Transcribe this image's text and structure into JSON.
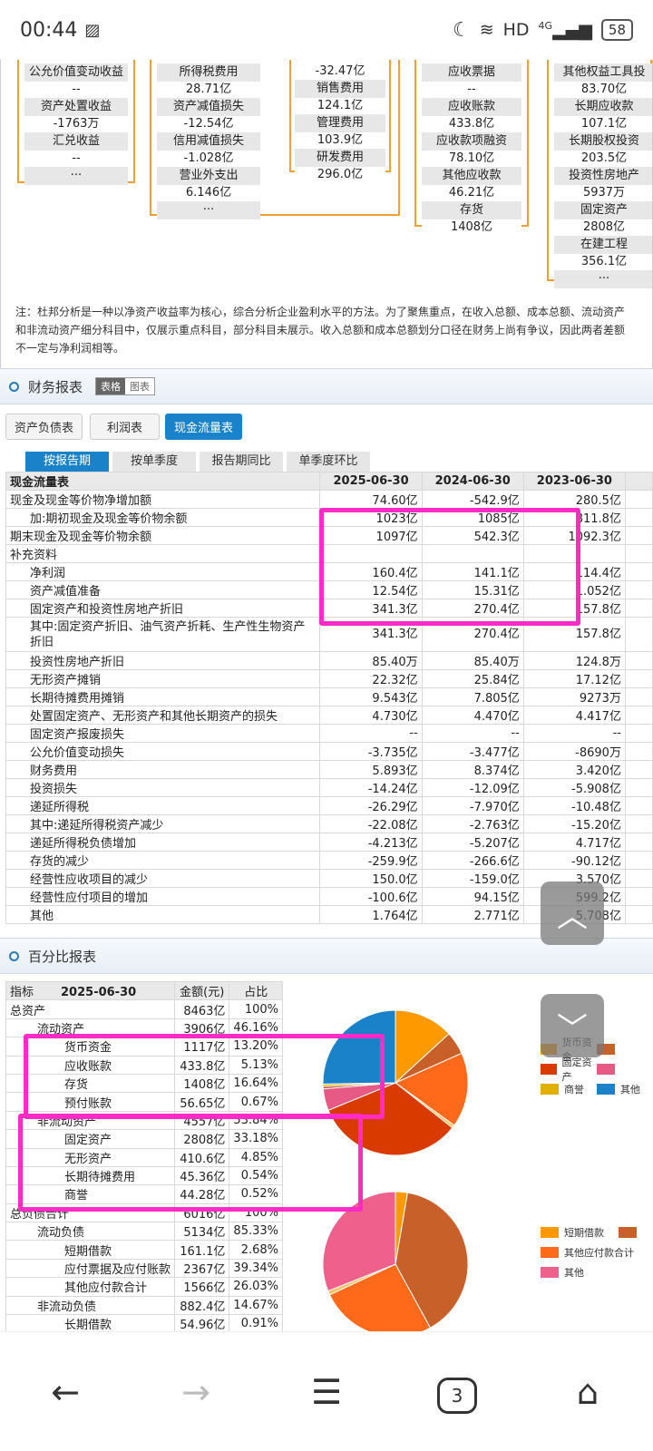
{
  "status": {
    "time": "00:44",
    "network": "HD",
    "signal": "4G",
    "battery": "58"
  },
  "dupont": {
    "col1": [
      {
        "label": "公允价值变动收益",
        "value": "--"
      },
      {
        "label": "资产处置收益",
        "value": "-1763万"
      },
      {
        "label": "汇兑收益",
        "value": "--"
      },
      {
        "label": "···",
        "value": ""
      }
    ],
    "col2": [
      {
        "label": "所得税费用",
        "value": "28.71亿"
      },
      {
        "label": "资产减值损失",
        "value": "-12.54亿"
      },
      {
        "label": "信用减值损失",
        "value": "-1.028亿"
      },
      {
        "label": "营业外支出",
        "value": "6.146亿"
      },
      {
        "label": "···",
        "value": ""
      }
    ],
    "col3_top_value": "-32.47亿",
    "col3": [
      {
        "label": "销售费用",
        "value": "124.1亿"
      },
      {
        "label": "管理费用",
        "value": "103.9亿"
      },
      {
        "label": "研发费用",
        "value": "296.0亿"
      }
    ],
    "col4": [
      {
        "label": "应收票据",
        "value": "--"
      },
      {
        "label": "应收账款",
        "value": "433.8亿"
      },
      {
        "label": "应收款项融资",
        "value": "78.10亿"
      },
      {
        "label": "其他应收款",
        "value": "46.21亿"
      },
      {
        "label": "存货",
        "value": "1408亿"
      }
    ],
    "col5": [
      {
        "label": "其他权益工具投",
        "value": "83.70亿"
      },
      {
        "label": "长期应收款",
        "value": "107.1亿"
      },
      {
        "label": "长期股权投资",
        "value": "203.5亿"
      },
      {
        "label": "投资性房地产",
        "value": "5937万"
      },
      {
        "label": "固定资产",
        "value": "2808亿"
      },
      {
        "label": "在建工程",
        "value": "356.1亿"
      },
      {
        "label": "···",
        "value": ""
      }
    ],
    "note": "注：杜邦分析是一种以净资产收益率为核心，综合分析企业盈利水平的方法。为了聚焦重点，在收入总额、成本总额、流动资产和非流动资产细分科目中，仅展示重点科目，部分科目未展示。收入总额和成本总额划分口径在财务上尚有争议，因此两者差额不一定与净利润相等。"
  },
  "finance": {
    "title": "财务报表",
    "view_table": "表格",
    "view_chart": "图表",
    "subtabs": [
      "资产负债表",
      "利润表",
      "现金流量表"
    ],
    "periods": [
      "按报告期",
      "按单季度",
      "报告期同比",
      "单季度环比"
    ],
    "header": [
      "现金流量表",
      "2025-06-30",
      "2024-06-30",
      "2023-06-30"
    ],
    "rows": [
      {
        "name": "现金及现金等价物净增加额",
        "v": [
          "74.60亿",
          "-542.9亿",
          "280.5亿"
        ],
        "ind": false
      },
      {
        "name": "加:期初现金及现金等价物余额",
        "v": [
          "1023亿",
          "1085亿",
          "811.8亿"
        ],
        "ind": true
      },
      {
        "name": "期末现金及现金等价物余额",
        "v": [
          "1097亿",
          "542.3亿",
          "1092.3亿"
        ],
        "ind": false
      },
      {
        "name": "补充资料",
        "v": [
          "",
          "",
          ""
        ],
        "ind": false
      },
      {
        "name": "净利润",
        "v": [
          "160.4亿",
          "141.1亿",
          "114.4亿"
        ],
        "ind": true
      },
      {
        "name": "资产减值准备",
        "v": [
          "12.54亿",
          "15.31亿",
          "1.052亿"
        ],
        "ind": true
      },
      {
        "name": "固定资产和投资性房地产折旧",
        "v": [
          "341.3亿",
          "270.4亿",
          "157.8亿"
        ],
        "ind": true
      },
      {
        "name": "其中:固定资产折旧、油气资产折耗、生产性生物资产折旧",
        "v": [
          "341.3亿",
          "270.4亿",
          "157.8亿"
        ],
        "ind": true,
        "tall": true
      },
      {
        "name": "投资性房地产折旧",
        "v": [
          "85.40万",
          "85.40万",
          "124.8万"
        ],
        "ind": true
      },
      {
        "name": "无形资产摊销",
        "v": [
          "22.32亿",
          "25.84亿",
          "17.12亿"
        ],
        "ind": true
      },
      {
        "name": "长期待摊费用摊销",
        "v": [
          "9.543亿",
          "7.805亿",
          "9273万"
        ],
        "ind": true
      },
      {
        "name": "处置固定资产、无形资产和其他长期资产的损失",
        "v": [
          "4.730亿",
          "4.470亿",
          "4.417亿"
        ],
        "ind": true
      },
      {
        "name": "固定资产报废损失",
        "v": [
          "--",
          "--",
          "--"
        ],
        "ind": true
      },
      {
        "name": "公允价值变动损失",
        "v": [
          "-3.735亿",
          "-3.477亿",
          "-8690万"
        ],
        "ind": true
      },
      {
        "name": "财务费用",
        "v": [
          "5.893亿",
          "8.374亿",
          "3.420亿"
        ],
        "ind": true
      },
      {
        "name": "投资损失",
        "v": [
          "-14.24亿",
          "-12.09亿",
          "-5.908亿"
        ],
        "ind": true
      },
      {
        "name": "递延所得税",
        "v": [
          "-26.29亿",
          "-7.970亿",
          "-10.48亿"
        ],
        "ind": true
      },
      {
        "name": "其中:递延所得税资产减少",
        "v": [
          "-22.08亿",
          "-2.763亿",
          "-15.20亿"
        ],
        "ind": true
      },
      {
        "name": "递延所得税负债增加",
        "v": [
          "-4.213亿",
          "-5.207亿",
          "4.717亿"
        ],
        "ind": true
      },
      {
        "name": "存货的减少",
        "v": [
          "-259.9亿",
          "-266.6亿",
          "-90.12亿"
        ],
        "ind": true
      },
      {
        "name": "经营性应收项目的减少",
        "v": [
          "150.0亿",
          "-159.0亿",
          "3.570亿"
        ],
        "ind": true
      },
      {
        "name": "经营性应付项目的增加",
        "v": [
          "-100.6亿",
          "94.15亿",
          "599.2亿"
        ],
        "ind": true
      },
      {
        "name": "其他",
        "v": [
          "1.764亿",
          "2.771亿",
          "5.708亿"
        ],
        "ind": true
      }
    ]
  },
  "percent": {
    "title": "百分比报表",
    "header": [
      "指标",
      "2025-06-30",
      "金额(元)",
      "占比"
    ],
    "rows": [
      {
        "name": "总资产",
        "amt": "8463亿",
        "pct": "100%",
        "lvl": 0
      },
      {
        "name": "流动资产",
        "amt": "3906亿",
        "pct": "46.16%",
        "lvl": 1
      },
      {
        "name": "货币资金",
        "amt": "1117亿",
        "pct": "13.20%",
        "lvl": 2
      },
      {
        "name": "应收账款",
        "amt": "433.8亿",
        "pct": "5.13%",
        "lvl": 2
      },
      {
        "name": "存货",
        "amt": "1408亿",
        "pct": "16.64%",
        "lvl": 2
      },
      {
        "name": "预付账款",
        "amt": "56.65亿",
        "pct": "0.67%",
        "lvl": 2
      },
      {
        "name": "非流动资产",
        "amt": "4557亿",
        "pct": "53.84%",
        "lvl": 1
      },
      {
        "name": "固定资产",
        "amt": "2808亿",
        "pct": "33.18%",
        "lvl": 2
      },
      {
        "name": "无形资产",
        "amt": "410.6亿",
        "pct": "4.85%",
        "lvl": 2
      },
      {
        "name": "长期待摊费用",
        "amt": "45.36亿",
        "pct": "0.54%",
        "lvl": 2
      },
      {
        "name": "商誉",
        "amt": "44.28亿",
        "pct": "0.52%",
        "lvl": 2
      },
      {
        "name": "总负债合计",
        "amt": "6016亿",
        "pct": "100%",
        "lvl": 0
      },
      {
        "name": "流动负债",
        "amt": "5134亿",
        "pct": "85.33%",
        "lvl": 1
      },
      {
        "name": "短期借款",
        "amt": "161.1亿",
        "pct": "2.68%",
        "lvl": 2
      },
      {
        "name": "应付票据及应付账款",
        "amt": "2367亿",
        "pct": "39.34%",
        "lvl": 2
      },
      {
        "name": "其他应付款合计",
        "amt": "1566亿",
        "pct": "26.03%",
        "lvl": 2
      },
      {
        "name": "非流动负债",
        "amt": "882.4亿",
        "pct": "14.67%",
        "lvl": 1
      },
      {
        "name": "长期借款",
        "amt": "54.96亿",
        "pct": "0.91%",
        "lvl": 2
      }
    ],
    "legend1": [
      {
        "label": "货币资金",
        "color": "#ff9900"
      },
      {
        "label": "固定资产",
        "color": "#d93a00"
      },
      {
        "label": "商誉",
        "color": "#e0b000"
      },
      {
        "label": "其他",
        "color": "#1a82c8"
      }
    ],
    "legend1_right_colors": [
      "#c8602a",
      "#e85a86"
    ],
    "legend2": [
      {
        "label": "短期借款",
        "color": "#ff9900"
      },
      {
        "label": "其他应付款合计",
        "color": "#ff6a1a"
      },
      {
        "label": "其他",
        "color": "#f0608c"
      }
    ],
    "legend2_right_colors": [
      "#c8602a"
    ]
  },
  "chart_data": [
    {
      "type": "pie",
      "labels": [
        "货币资金",
        "应收账款",
        "存货",
        "预付账款",
        "固定资产",
        "无形资产",
        "长期待摊费用",
        "商誉",
        "其他"
      ],
      "values": [
        13.2,
        5.13,
        16.64,
        0.67,
        33.18,
        4.85,
        0.54,
        0.52,
        25.27
      ],
      "colors": [
        "#ff9900",
        "#c8602a",
        "#ff6a1a",
        "#f7c060",
        "#d93a00",
        "#e85a86",
        "#b05030",
        "#e0b000",
        "#1a82c8"
      ]
    },
    {
      "type": "pie",
      "labels": [
        "短期借款",
        "应付票据及应付账款",
        "其他应付款合计",
        "长期借款",
        "其他"
      ],
      "values": [
        2.68,
        39.34,
        26.03,
        0.91,
        31.04
      ],
      "colors": [
        "#ff9900",
        "#c8602a",
        "#ff6a1a",
        "#f7c060",
        "#f0608c"
      ]
    }
  ],
  "nav": {
    "back": "←",
    "forward": "→",
    "menu": "☰",
    "tabs": "3",
    "home": "⌂"
  }
}
